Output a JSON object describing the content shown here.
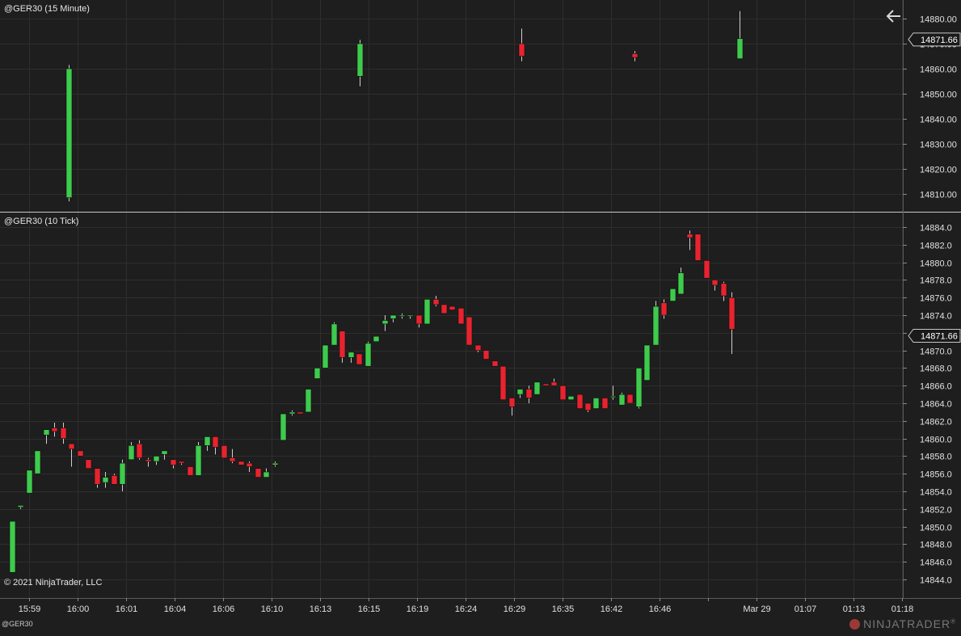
{
  "panels": {
    "top_title": "@GER30 (15 Minute)",
    "bottom_title": "@GER30 (10 Tick)",
    "copyright": "© 2021 NinjaTrader, LLC",
    "tab_label": "@GER30",
    "brand": "NINJATRADER",
    "brand_mark": "®"
  },
  "colors": {
    "background": "#1e1e1e",
    "grid": "#2e2e2e",
    "up": "#3ecb4d",
    "down": "#e8232f",
    "price_marker_bg": "#1a1a1a",
    "price_marker_border": "#c8c8c8"
  },
  "chart_data": [
    {
      "type": "candlestick",
      "title": "@GER30 (15 Minute)",
      "ylim": [
        14805,
        14884
      ],
      "yticks": [
        14880.0,
        14870.0,
        14860.0,
        14850.0,
        14840.0,
        14830.0,
        14820.0,
        14810.0
      ],
      "last_price": 14871.66,
      "candles": [
        {
          "x": "16:00",
          "o": 14808.5,
          "h": 14861.5,
          "l": 14807.0,
          "c": 14860.0
        },
        {
          "x": "16:15",
          "o": 14857.0,
          "h": 14871.5,
          "l": 14853.0,
          "c": 14870.0
        },
        {
          "x": "16:29",
          "o": 14870.0,
          "h": 14876.0,
          "l": 14863.0,
          "c": 14865.0
        },
        {
          "x": "16:42",
          "o": 14866.0,
          "h": 14867.0,
          "l": 14863.0,
          "c": 14864.5
        },
        {
          "x": "Mar 29",
          "o": 14864.0,
          "h": 14883.0,
          "l": 14864.0,
          "c": 14872.0
        }
      ]
    },
    {
      "type": "candlestick",
      "title": "@GER30 (10 Tick)",
      "ylim": [
        14843,
        14886
      ],
      "yticks": [
        14884.0,
        14882.0,
        14880.0,
        14878.0,
        14876.0,
        14874.0,
        14872.0,
        14870.0,
        14868.0,
        14866.0,
        14864.0,
        14862.0,
        14860.0,
        14858.0,
        14856.0,
        14854.0,
        14852.0,
        14850.0,
        14848.0,
        14846.0,
        14844.0
      ],
      "last_price": 14871.66,
      "candles": [
        {
          "o": 14844.8,
          "h": 14850.6,
          "l": 14844.8,
          "c": 14850.6
        },
        {
          "o": 14852.2,
          "h": 14852.4,
          "l": 14852.0,
          "c": 14852.4
        },
        {
          "o": 14853.8,
          "h": 14856.4,
          "l": 14853.8,
          "c": 14856.4
        },
        {
          "o": 14856.0,
          "h": 14858.6,
          "l": 14856.0,
          "c": 14858.6
        },
        {
          "o": 14860.4,
          "h": 14861.0,
          "l": 14859.4,
          "c": 14861.0
        },
        {
          "o": 14861.2,
          "h": 14861.8,
          "l": 14860.2,
          "c": 14860.8
        },
        {
          "o": 14861.2,
          "h": 14861.8,
          "l": 14859.4,
          "c": 14860.0
        },
        {
          "o": 14859.4,
          "h": 14859.4,
          "l": 14856.8,
          "c": 14858.8
        },
        {
          "o": 14858.6,
          "h": 14858.6,
          "l": 14858.0,
          "c": 14858.0
        },
        {
          "o": 14857.6,
          "h": 14857.6,
          "l": 14856.6,
          "c": 14856.6
        },
        {
          "o": 14856.6,
          "h": 14856.6,
          "l": 14854.4,
          "c": 14854.8
        },
        {
          "o": 14855.0,
          "h": 14856.2,
          "l": 14854.4,
          "c": 14855.6
        },
        {
          "o": 14855.8,
          "h": 14856.0,
          "l": 14854.8,
          "c": 14854.8
        },
        {
          "o": 14854.8,
          "h": 14857.6,
          "l": 14854.0,
          "c": 14857.2
        },
        {
          "o": 14857.6,
          "h": 14859.6,
          "l": 14857.6,
          "c": 14859.2
        },
        {
          "o": 14859.4,
          "h": 14859.8,
          "l": 14857.6,
          "c": 14857.8
        },
        {
          "o": 14857.6,
          "h": 14857.8,
          "l": 14856.8,
          "c": 14857.4
        },
        {
          "o": 14857.4,
          "h": 14858.0,
          "l": 14857.0,
          "c": 14858.0
        },
        {
          "o": 14858.2,
          "h": 14858.6,
          "l": 14857.6,
          "c": 14858.6
        },
        {
          "o": 14857.6,
          "h": 14857.6,
          "l": 14856.6,
          "c": 14857.0
        },
        {
          "o": 14857.4,
          "h": 14857.4,
          "l": 14857.0,
          "c": 14857.2
        },
        {
          "o": 14856.8,
          "h": 14856.8,
          "l": 14855.8,
          "c": 14855.8
        },
        {
          "o": 14855.8,
          "h": 14859.6,
          "l": 14855.8,
          "c": 14859.2
        },
        {
          "o": 14859.2,
          "h": 14860.2,
          "l": 14858.6,
          "c": 14860.2
        },
        {
          "o": 14860.2,
          "h": 14860.2,
          "l": 14858.2,
          "c": 14859.0
        },
        {
          "o": 14859.2,
          "h": 14859.2,
          "l": 14857.8,
          "c": 14857.8
        },
        {
          "o": 14857.8,
          "h": 14858.8,
          "l": 14857.2,
          "c": 14857.4
        },
        {
          "o": 14857.4,
          "h": 14857.4,
          "l": 14857.0,
          "c": 14857.0
        },
        {
          "o": 14857.2,
          "h": 14857.4,
          "l": 14856.2,
          "c": 14856.8
        },
        {
          "o": 14856.6,
          "h": 14856.6,
          "l": 14855.6,
          "c": 14855.6
        },
        {
          "o": 14855.6,
          "h": 14856.6,
          "l": 14855.6,
          "c": 14856.2
        },
        {
          "o": 14857.0,
          "h": 14857.4,
          "l": 14856.8,
          "c": 14857.2
        },
        {
          "o": 14859.8,
          "h": 14862.8,
          "l": 14859.8,
          "c": 14862.8
        },
        {
          "o": 14862.8,
          "h": 14863.2,
          "l": 14862.6,
          "c": 14863.0
        },
        {
          "o": 14863.0,
          "h": 14863.0,
          "l": 14862.8,
          "c": 14862.8
        },
        {
          "o": 14863.0,
          "h": 14865.6,
          "l": 14863.0,
          "c": 14865.6
        },
        {
          "o": 14866.8,
          "h": 14868.0,
          "l": 14866.8,
          "c": 14868.0
        },
        {
          "o": 14868.0,
          "h": 14868.0,
          "l": 14868.0,
          "c": 14870.6
        },
        {
          "o": 14870.6,
          "h": 14873.2,
          "l": 14870.6,
          "c": 14873.0
        },
        {
          "o": 14872.2,
          "h": 14872.2,
          "l": 14868.6,
          "c": 14869.2
        },
        {
          "o": 14869.2,
          "h": 14869.8,
          "l": 14868.6,
          "c": 14869.8
        },
        {
          "o": 14869.6,
          "h": 14869.6,
          "l": 14868.4,
          "c": 14868.4
        },
        {
          "o": 14868.2,
          "h": 14871.0,
          "l": 14868.2,
          "c": 14870.8
        },
        {
          "o": 14871.0,
          "h": 14871.6,
          "l": 14871.0,
          "c": 14871.6
        },
        {
          "o": 14873.0,
          "h": 14874.0,
          "l": 14872.2,
          "c": 14873.4
        },
        {
          "o": 14873.6,
          "h": 14874.0,
          "l": 14873.2,
          "c": 14874.0
        },
        {
          "o": 14874.0,
          "h": 14874.2,
          "l": 14873.6,
          "c": 14874.0
        },
        {
          "o": 14874.0,
          "h": 14874.0,
          "l": 14873.6,
          "c": 14874.0
        },
        {
          "o": 14874.0,
          "h": 14874.0,
          "l": 14872.6,
          "c": 14873.0
        },
        {
          "o": 14873.0,
          "h": 14875.8,
          "l": 14873.0,
          "c": 14875.8
        },
        {
          "o": 14875.8,
          "h": 14876.2,
          "l": 14875.0,
          "c": 14875.2
        },
        {
          "o": 14875.2,
          "h": 14875.2,
          "l": 14874.2,
          "c": 14874.2
        },
        {
          "o": 14875.0,
          "h": 14875.0,
          "l": 14874.6,
          "c": 14874.6
        },
        {
          "o": 14874.8,
          "h": 14874.8,
          "l": 14873.0,
          "c": 14873.0
        },
        {
          "o": 14873.8,
          "h": 14873.8,
          "l": 14870.6,
          "c": 14870.6
        },
        {
          "o": 14870.6,
          "h": 14870.6,
          "l": 14869.8,
          "c": 14870.0
        },
        {
          "o": 14870.0,
          "h": 14870.0,
          "l": 14869.0,
          "c": 14869.0
        },
        {
          "o": 14868.8,
          "h": 14868.8,
          "l": 14868.2,
          "c": 14868.2
        },
        {
          "o": 14868.2,
          "h": 14868.2,
          "l": 14864.4,
          "c": 14864.4
        },
        {
          "o": 14864.6,
          "h": 14864.6,
          "l": 14862.6,
          "c": 14863.6
        },
        {
          "o": 14865.0,
          "h": 14865.6,
          "l": 14864.6,
          "c": 14865.6
        },
        {
          "o": 14865.6,
          "h": 14866.0,
          "l": 14864.0,
          "c": 14864.6
        },
        {
          "o": 14865.0,
          "h": 14866.4,
          "l": 14865.0,
          "c": 14866.4
        },
        {
          "o": 14866.2,
          "h": 14866.2,
          "l": 14866.0,
          "c": 14866.0
        },
        {
          "o": 14866.4,
          "h": 14866.8,
          "l": 14866.0,
          "c": 14866.0
        },
        {
          "o": 14866.0,
          "h": 14866.0,
          "l": 14864.4,
          "c": 14864.4
        },
        {
          "o": 14864.4,
          "h": 14864.8,
          "l": 14864.4,
          "c": 14864.8
        },
        {
          "o": 14865.0,
          "h": 14865.0,
          "l": 14863.4,
          "c": 14863.4
        },
        {
          "o": 14864.0,
          "h": 14864.0,
          "l": 14863.0,
          "c": 14863.2
        },
        {
          "o": 14863.4,
          "h": 14864.6,
          "l": 14863.4,
          "c": 14864.6
        },
        {
          "o": 14864.6,
          "h": 14864.6,
          "l": 14863.4,
          "c": 14863.4
        },
        {
          "o": 14864.8,
          "h": 14866.0,
          "l": 14864.4,
          "c": 14864.8
        },
        {
          "o": 14863.8,
          "h": 14865.2,
          "l": 14863.8,
          "c": 14865.0
        },
        {
          "o": 14865.0,
          "h": 14865.0,
          "l": 14864.0,
          "c": 14864.0
        },
        {
          "o": 14863.6,
          "h": 14868.0,
          "l": 14863.4,
          "c": 14868.0
        },
        {
          "o": 14866.6,
          "h": 14870.6,
          "l": 14866.6,
          "c": 14870.6
        },
        {
          "o": 14870.6,
          "h": 14875.6,
          "l": 14870.6,
          "c": 14875.0
        },
        {
          "o": 14875.4,
          "h": 14875.8,
          "l": 14873.6,
          "c": 14874.0
        },
        {
          "o": 14875.6,
          "h": 14877.0,
          "l": 14875.6,
          "c": 14877.0
        },
        {
          "o": 14876.4,
          "h": 14879.4,
          "l": 14876.4,
          "c": 14878.8
        },
        {
          "o": 14883.2,
          "h": 14883.6,
          "l": 14881.4,
          "c": 14882.8
        },
        {
          "o": 14883.2,
          "h": 14883.2,
          "l": 14880.2,
          "c": 14880.2
        },
        {
          "o": 14880.2,
          "h": 14880.2,
          "l": 14878.2,
          "c": 14878.2
        },
        {
          "o": 14878.0,
          "h": 14878.0,
          "l": 14876.8,
          "c": 14877.4
        },
        {
          "o": 14877.6,
          "h": 14877.8,
          "l": 14875.6,
          "c": 14876.2
        },
        {
          "o": 14876.0,
          "h": 14876.6,
          "l": 14869.6,
          "c": 14872.4
        }
      ]
    }
  ],
  "x_axis": {
    "labels": [
      "15:59",
      "16:00",
      "16:01",
      "16:04",
      "16:06",
      "16:10",
      "16:13",
      "16:15",
      "16:19",
      "16:24",
      "16:29",
      "16:35",
      "16:42",
      "16:46",
      "",
      "Mar 29",
      "01:07",
      "01:13",
      "01:18"
    ]
  }
}
